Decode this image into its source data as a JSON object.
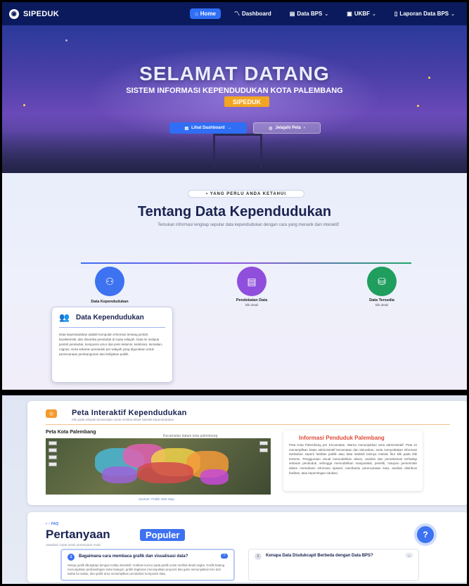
{
  "nav": {
    "brand": "SIPEDUK",
    "items": [
      {
        "label": "Home",
        "icon": "home-icon",
        "active": true
      },
      {
        "label": "Dashboard",
        "icon": "chart-line-icon",
        "active": false
      },
      {
        "label": "Data BPS",
        "icon": "table-icon",
        "active": false,
        "dropdown": true
      },
      {
        "label": "UKBF",
        "icon": "document-icon",
        "active": false,
        "dropdown": true
      },
      {
        "label": "Laporan Data BPS",
        "icon": "report-icon",
        "active": false,
        "dropdown": true
      }
    ]
  },
  "hero": {
    "title": "SELAMAT DATANG",
    "subtitle": "SISTEM INFORMASI KEPENDUDUKAN KOTA PALEMBANG",
    "badge": "SIPEDUK",
    "btn_dashboard": "Lihat Dashboard",
    "btn_peta": "Jelajahi Peta"
  },
  "about": {
    "pill": "YANG PERLU ANDA KETAHUI",
    "title": "Tentang Data Kependudukan",
    "desc": "Temukan informasi lengkap seputar data kependudukan dengan cara yang menarik dan interaktif",
    "features": [
      {
        "title": "Data Kependudukan",
        "sub": ""
      },
      {
        "title": "Pendekatan Data",
        "sub": "klik detail"
      },
      {
        "title": "Data Tersedia",
        "sub": "klik detail"
      }
    ],
    "popup": {
      "title": "Data Kependudukan",
      "text": "Data kependudukan adalah kumpulan informasi tentang jumlah, karakteristik, dan dinamika penduduk di suatu wilayah. Data ini meliputi jumlah penduduk, komposisi umur dan jenis kelamin, kelahiran, kematian, migrasi, serta sebaran penduduk per wilayah yang digunakan untuk perencanaan pembangunan dan kebijakan publik."
    }
  },
  "map": {
    "title": "Peta Interaktif Kependudukan",
    "subtitle": "Klik pada wilayah kecamatan untuk melihat detail statistik kependudukan",
    "label": "Peta Kota Palembang",
    "caption": "Kecamatan dalam kota palembang",
    "footer": "Sumber: Publik Web Map",
    "info_title": "Informasi Penduduk Palembang",
    "info_text": "Peta Kota Palembang per Kecamatan. Warna menunjukkan area administratif. Peta ini menampilkan batas administratif kecamatan dan kelurahan, serta menyediakan informasi tambahan seperti fasilitas publik atau data statistik lainnya melalui fitur klik pada titik tertentu. Penggunaan visual memudahkan akses, analisis dan pemahaman terhadap sebaran penduduk, sehingga memudahkan masyarakat, peneliti, maupun pemerintah dalam memahami informasi spasial, membantu perencanaan kota, analisis distribusi fasilitas, atau kepentingan edukasi."
  },
  "faq": {
    "tag": "FAQ",
    "title": "Pertanyaan",
    "title_highlight": "Populer",
    "desc": "Jawaban cepat untuk pertanyaan Anda",
    "questions": [
      {
        "num": "1",
        "q": "Bagaimana cara membaca grafik dan visualisasi data?",
        "a": "Setiap grafik dilengkapi dengan tooltip interaktif. Arahkan kursor pada grafik untuk melihat detail angka. Grafik batang menunjukkan perbandingan antar kategori, grafik lingkaran menunjukkan proporsi dan garis menunjukkan tren dari waktu ke waktu, dan grafik area menampilkan perubahan komposisi data."
      },
      {
        "num": "2",
        "q": "Kenapa Data Disdukcapil Berbeda dengan Data BPS?",
        "a": ""
      }
    ]
  }
}
